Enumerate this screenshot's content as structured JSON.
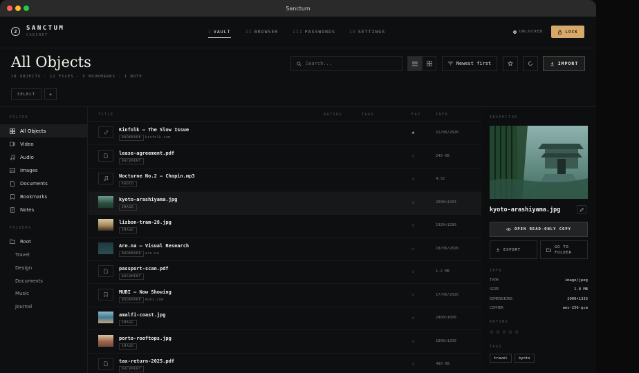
{
  "window": {
    "title": "Sanctum"
  },
  "brand": {
    "logo": "2",
    "name": "SANCTUM",
    "sub": "CABINET"
  },
  "nav": [
    {
      "num": "I",
      "label": "VAULT",
      "active": true
    },
    {
      "num": "II",
      "label": "BROWSER"
    },
    {
      "num": "III",
      "label": "PASSWORDS"
    },
    {
      "num": "IV",
      "label": "SETTINGS"
    }
  ],
  "status": {
    "unlocked": "UNLOCKED",
    "lock_label": "LOCK"
  },
  "page": {
    "title": "All Objects",
    "stats": "18 OBJECTS · 12 FILES · 5 BOOKMARKS · 1 NOTE",
    "select_label": "SELECT",
    "plus_label": "+"
  },
  "toolbar": {
    "search_placeholder": "Search...",
    "sort_label": "Newest first",
    "import_label": "IMPORT"
  },
  "sidebar": {
    "filter_heading": "FILTER",
    "items": [
      {
        "label": "All Objects",
        "icon": "grid-icon",
        "active": true
      },
      {
        "label": "Video",
        "icon": "video-icon"
      },
      {
        "label": "Audio",
        "icon": "music-icon"
      },
      {
        "label": "Images",
        "icon": "image-icon"
      },
      {
        "label": "Documents",
        "icon": "document-icon"
      },
      {
        "label": "Bookmarks",
        "icon": "bookmark-icon"
      },
      {
        "label": "Notes",
        "icon": "note-icon"
      }
    ],
    "folders_heading": "FOLDERS",
    "root": "Root",
    "folders": [
      "Travel",
      "Design",
      "Documents",
      "Music",
      "Journal"
    ]
  },
  "table": {
    "headers": {
      "title": "TITLE",
      "rating": "RATING",
      "tags": "TAGS",
      "fav": "FAV",
      "info": "INFO"
    },
    "rows": [
      {
        "name": "Kinfolk — The Slow Issue",
        "badge": "BOOKMARK",
        "source": "kinfolk.com",
        "fav": true,
        "info": "21/06/2026",
        "kind": "bookmark"
      },
      {
        "name": "lease-agreement.pdf",
        "badge": "DOCUMENT",
        "source": "",
        "fav": false,
        "info": "240 KB",
        "kind": "document"
      },
      {
        "name": "Nocturne No.2 — Chopin.mp3",
        "badge": "AUDIO",
        "source": "",
        "fav": false,
        "info": "4:32",
        "kind": "audio"
      },
      {
        "name": "kyoto-arashiyama.jpg",
        "badge": "IMAGE",
        "source": "",
        "fav": false,
        "info": "2000×1333",
        "kind": "image-kyoto",
        "selected": true
      },
      {
        "name": "lisbon-tram-28.jpg",
        "badge": "IMAGE",
        "source": "",
        "fav": false,
        "info": "1920×1280",
        "kind": "image-lisbon"
      },
      {
        "name": "Are.na — Visual Research",
        "badge": "BOOKMARK",
        "source": "are.na",
        "fav": false,
        "info": "18/06/2026",
        "kind": "image-arena"
      },
      {
        "name": "passport-scan.pdf",
        "badge": "DOCUMENT",
        "source": "",
        "fav": false,
        "info": "1.2 MB",
        "kind": "document"
      },
      {
        "name": "MUBI — Now Showing",
        "badge": "BOOKMARK",
        "source": "mubi.com",
        "fav": false,
        "info": "17/06/2026",
        "kind": "bookmark2"
      },
      {
        "name": "amalfi-coast.jpg",
        "badge": "IMAGE",
        "source": "",
        "fav": false,
        "info": "2400×1600",
        "kind": "image-amalfi"
      },
      {
        "name": "porto-rooftops.jpg",
        "badge": "IMAGE",
        "source": "",
        "fav": false,
        "info": "1800×1200",
        "kind": "image-porto"
      },
      {
        "name": "tax-return-2025.pdf",
        "badge": "DOCUMENT",
        "source": "",
        "fav": false,
        "info": "480 KB",
        "kind": "document"
      }
    ]
  },
  "inspector": {
    "heading": "INSPECTOR",
    "filename": "kyoto-arashiyama.jpg",
    "open_label": "OPEN READ-ONLY COPY",
    "export_label": "EXPORT",
    "goto_label_1": "GO TO",
    "goto_label_2": "FOLDER",
    "info_heading": "INFO",
    "info": [
      {
        "key": "TYPE",
        "value": "image/jpeg"
      },
      {
        "key": "SIZE",
        "value": "1.8 MB"
      },
      {
        "key": "DIMENSIONS",
        "value": "2000×1333"
      },
      {
        "key": "CIPHER",
        "value": "aes-256-gcm"
      }
    ],
    "rating_heading": "RATING",
    "rating_stars": "☆☆☆☆☆",
    "rating_value": 0,
    "tags_heading": "TAGS",
    "tags": [
      "travel",
      "kyoto"
    ]
  },
  "colors": {
    "accent": "#d6a86a",
    "bg": "#0e0f10",
    "close": "#ff5f57",
    "min": "#febc2e",
    "max": "#28c840"
  }
}
